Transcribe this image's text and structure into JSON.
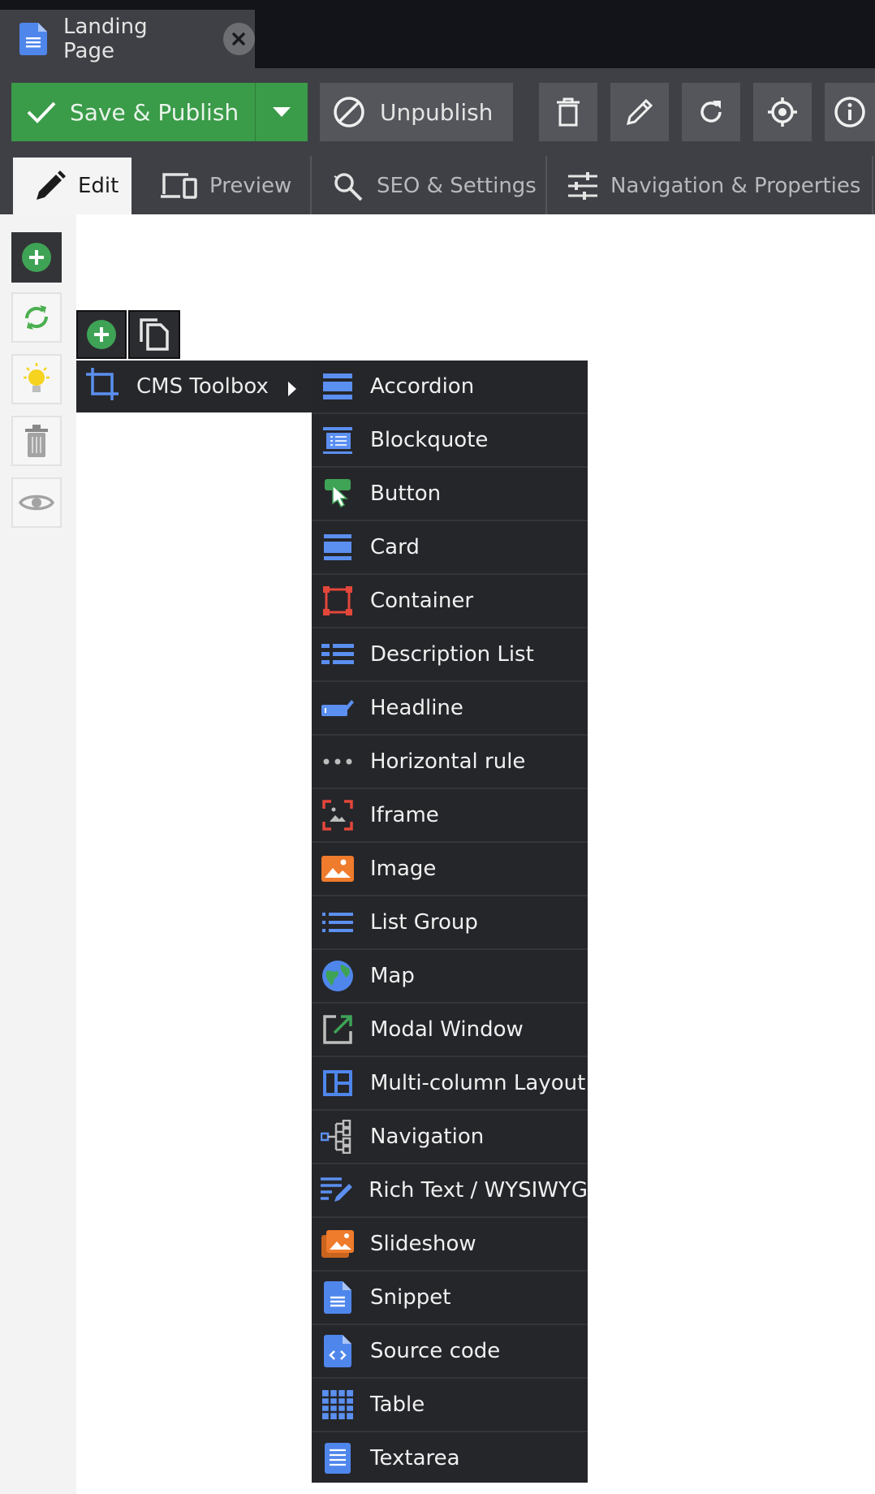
{
  "document_tab": {
    "title": "Landing Page"
  },
  "toolbar": {
    "save_label": "Save & Publish",
    "unpublish_label": "Unpublish"
  },
  "mode_tabs": [
    {
      "label": "Edit",
      "active": true
    },
    {
      "label": "Preview"
    },
    {
      "label": "SEO & Settings"
    },
    {
      "label": "Navigation & Properties"
    }
  ],
  "toolbox": {
    "label": "CMS Toolbox",
    "items": [
      {
        "label": "Accordion",
        "icon": "accordion-icon"
      },
      {
        "label": "Blockquote",
        "icon": "blockquote-icon"
      },
      {
        "label": "Button",
        "icon": "button-icon"
      },
      {
        "label": "Card",
        "icon": "card-icon"
      },
      {
        "label": "Container",
        "icon": "container-icon"
      },
      {
        "label": "Description List",
        "icon": "description-list-icon"
      },
      {
        "label": "Headline",
        "icon": "headline-icon"
      },
      {
        "label": "Horizontal rule",
        "icon": "horizontal-rule-icon"
      },
      {
        "label": "Iframe",
        "icon": "iframe-icon"
      },
      {
        "label": "Image",
        "icon": "image-icon"
      },
      {
        "label": "List Group",
        "icon": "list-group-icon"
      },
      {
        "label": "Map",
        "icon": "map-icon"
      },
      {
        "label": "Modal Window",
        "icon": "modal-window-icon"
      },
      {
        "label": "Multi-column Layout",
        "icon": "multi-column-layout-icon"
      },
      {
        "label": "Navigation",
        "icon": "navigation-icon"
      },
      {
        "label": "Rich Text / WYSIWYG",
        "icon": "rich-text-icon"
      },
      {
        "label": "Slideshow",
        "icon": "slideshow-icon"
      },
      {
        "label": "Snippet",
        "icon": "snippet-icon"
      },
      {
        "label": "Source code",
        "icon": "source-code-icon"
      },
      {
        "label": "Table",
        "icon": "table-icon"
      },
      {
        "label": "Textarea",
        "icon": "textarea-icon"
      }
    ]
  },
  "colors": {
    "accent_green": "#3a9b49",
    "toolbar_bg": "#3f4045",
    "menu_bg": "#25262a",
    "icon_blue": "#5b8ff0"
  }
}
